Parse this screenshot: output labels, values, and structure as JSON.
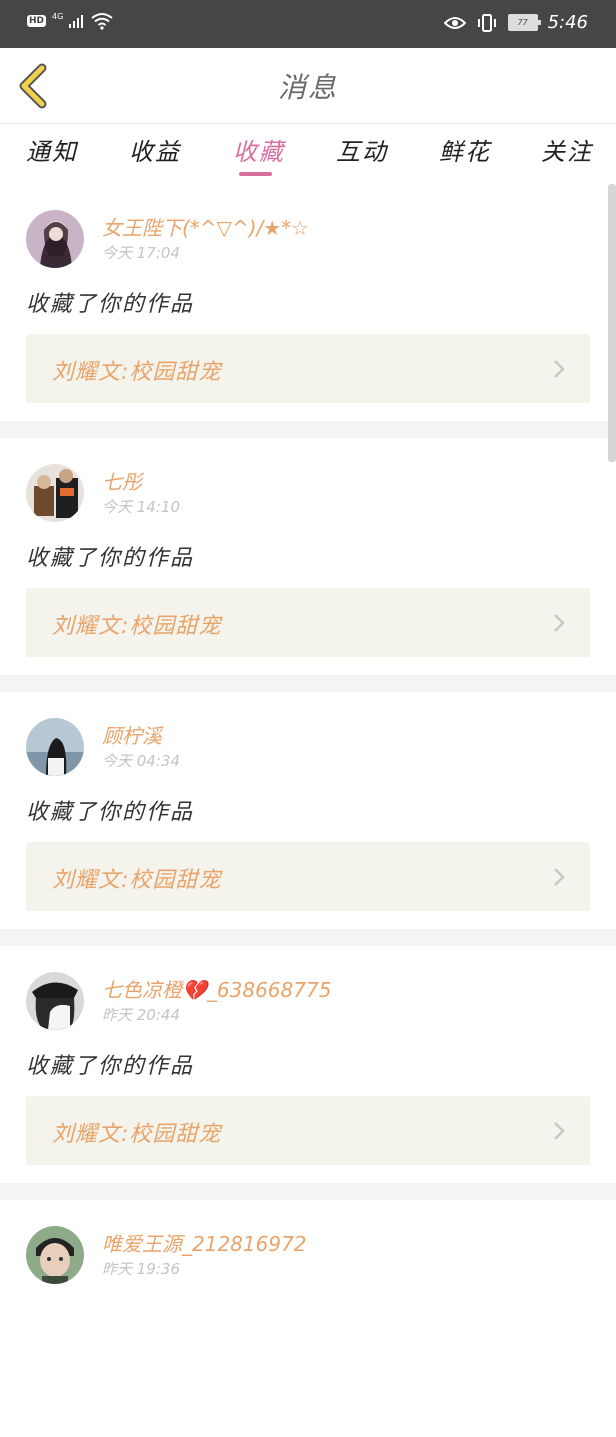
{
  "status_bar": {
    "hd": "HD",
    "network": "4G",
    "battery": "77",
    "time": "5:46"
  },
  "header": {
    "title": "消息",
    "back_icon": "chevron-left-icon"
  },
  "tabs": [
    {
      "label": "通知",
      "active": false
    },
    {
      "label": "收益",
      "active": false
    },
    {
      "label": "收藏",
      "active": true
    },
    {
      "label": "互动",
      "active": false
    },
    {
      "label": "鲜花",
      "active": false
    },
    {
      "label": "关注",
      "active": false
    }
  ],
  "colors": {
    "accent": "#d96fa0",
    "name": "#e8a46a",
    "statusbar": "#464646",
    "work_bg": "#f4f3ec"
  },
  "items": [
    {
      "name": "女王陛下(*^▽^)/★*☆",
      "time": "今天 17:04",
      "action": "收藏了你的作品",
      "work": "刘耀文:校园甜宠"
    },
    {
      "name": "七彤",
      "time": "今天 14:10",
      "action": "收藏了你的作品",
      "work": "刘耀文:校园甜宠"
    },
    {
      "name": "顾柠溪",
      "time": "今天 04:34",
      "action": "收藏了你的作品",
      "work": "刘耀文:校园甜宠"
    },
    {
      "name": "七色凉橙💔_638668775",
      "time": "昨天 20:44",
      "action": "收藏了你的作品",
      "work": "刘耀文:校园甜宠"
    },
    {
      "name": "唯爱王源_212816972",
      "time": "昨天 19:36",
      "action": "",
      "work": ""
    }
  ]
}
